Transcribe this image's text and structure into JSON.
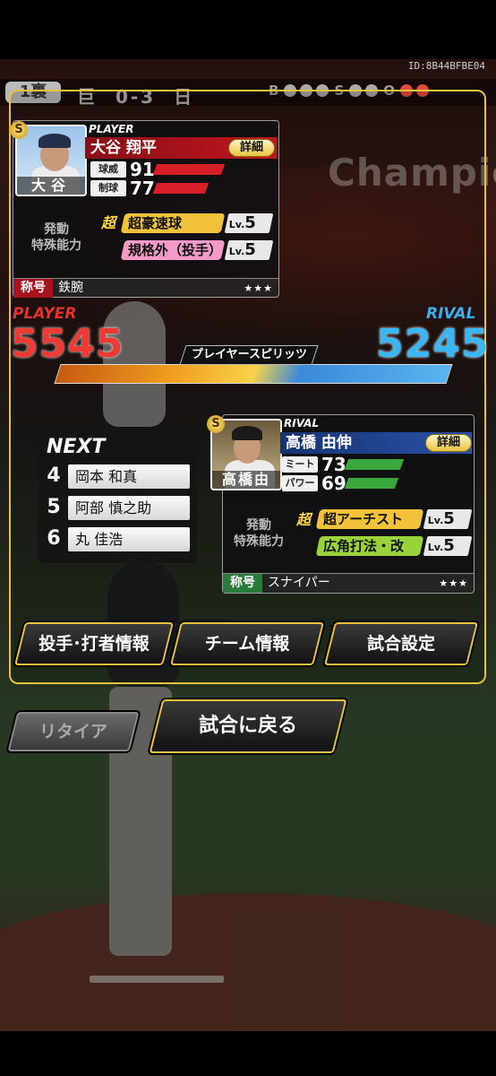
{
  "header": {
    "id_label": "ID:8B44BFBE04",
    "inning": "1裏",
    "away_team_short": "巨",
    "score": "0-3",
    "home_team_short": "日",
    "count_labels": {
      "ball": "B",
      "strike": "S",
      "out": "O"
    },
    "balls": 0,
    "strikes": 0,
    "outs": 2
  },
  "background": {
    "stadium_text": "Champio"
  },
  "player_card": {
    "tag": "PLAYER",
    "full_name": "大谷 翔平",
    "short_name": "大谷",
    "detail_button": "詳細",
    "stats": [
      {
        "label": "球威",
        "value": "91"
      },
      {
        "label": "制球",
        "value": "77"
      }
    ],
    "ability_section_label": "発動\n特殊能力",
    "abilities": [
      {
        "prefix": "超",
        "name": "超豪速球",
        "level_prefix": "Lv.",
        "level": "5",
        "color": "#f2c23a"
      },
      {
        "prefix": "",
        "name": "規格外（投手）",
        "level_prefix": "Lv.",
        "level": "5",
        "color": "#f49ac8"
      }
    ],
    "title_label": "称号",
    "title_value": "鉄腕",
    "stars": "★★★",
    "accent_color": "#a8121c"
  },
  "scores": {
    "player_label": "PLAYER",
    "player_score": "5545",
    "rival_label": "RIVAL",
    "rival_score": "5245",
    "spirits_label": "プレイヤースピリッツ",
    "player_color": "#e6322e",
    "rival_color": "#3ab0f0",
    "player_share": 0.514
  },
  "next_batters": {
    "heading": "NEXT",
    "batters": [
      {
        "order": "4",
        "name": "岡本 和真"
      },
      {
        "order": "5",
        "name": "阿部 慎之助"
      },
      {
        "order": "6",
        "name": "丸 佳浩"
      }
    ]
  },
  "rival_card": {
    "tag": "RIVAL",
    "full_name": "高橋 由伸",
    "short_name": "高橋由",
    "detail_button": "詳細",
    "stats": [
      {
        "label": "ミート",
        "value": "73"
      },
      {
        "label": "パワー",
        "value": "69"
      }
    ],
    "ability_section_label": "発動\n特殊能力",
    "abilities": [
      {
        "prefix": "超",
        "name": "超アーチスト",
        "level_prefix": "Lv.",
        "level": "5",
        "color": "#f2c23a"
      },
      {
        "prefix": "",
        "name": "広角打法・改",
        "level_prefix": "Lv.",
        "level": "5",
        "color": "#9ad23a"
      }
    ],
    "title_label": "称号",
    "title_value": "スナイパー",
    "stars": "★★★",
    "accent_color": "#1e3e8c"
  },
  "buttons": {
    "info": "投手･打者情報",
    "team": "チーム情報",
    "settings": "試合設定",
    "retire": "リタイア",
    "return": "試合に戻る"
  }
}
